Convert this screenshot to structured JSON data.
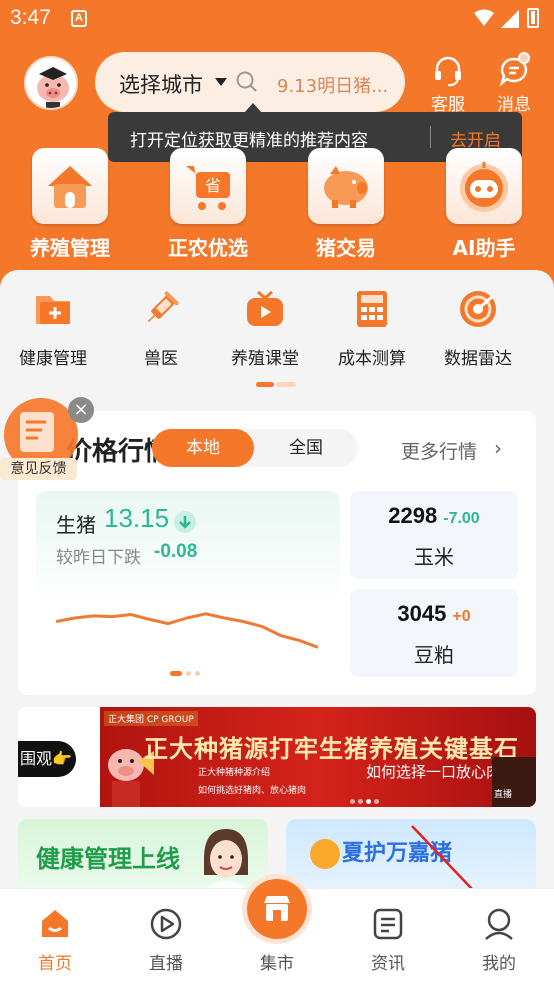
{
  "status_bar": {
    "time": "3:47",
    "app_icon_letter": "A"
  },
  "header": {
    "city_label": "选择城市",
    "search_placeholder": "9.13明日猪...",
    "actions": {
      "service": "客服",
      "messages": "消息"
    },
    "colors": {
      "brand": "#f5772a",
      "tooltip_bg": "#3a3a3a"
    }
  },
  "tooltip": {
    "text": "打开定位获取更精准的推荐内容",
    "action": "去开启"
  },
  "main_tiles": [
    {
      "label": "养殖管理",
      "icon": "house-icon"
    },
    {
      "label": "正农优选",
      "icon": "shopping-cart-icon"
    },
    {
      "label": "猪交易",
      "icon": "piggy-icon"
    },
    {
      "label": "AI助手",
      "icon": "robot-icon"
    }
  ],
  "grid_items": [
    {
      "label": "健康管理",
      "icon": "health-folder-icon"
    },
    {
      "label": "兽医",
      "icon": "syringe-icon"
    },
    {
      "label": "养殖课堂",
      "icon": "tv-play-icon"
    },
    {
      "label": "成本测算",
      "icon": "calculator-icon"
    },
    {
      "label": "数据雷达",
      "icon": "radar-icon"
    }
  ],
  "feedback": {
    "label": "意见反馈"
  },
  "price_market": {
    "title": "价格行情",
    "tabs": [
      "本地",
      "全国"
    ],
    "active_tab": "本地",
    "more": "更多行情",
    "hog": {
      "name": "生猪",
      "price": "13.15",
      "change_label": "较昨日下跌",
      "change": "-0.08",
      "trend": [
        0.55,
        0.5,
        0.47,
        0.48,
        0.45,
        0.52,
        0.58,
        0.5,
        0.44,
        0.5,
        0.55,
        0.62,
        0.75,
        0.82,
        0.92
      ]
    },
    "corn": {
      "name": "玉米",
      "price": "2298",
      "change": "-7.00",
      "change_color": "#2bb894"
    },
    "meal": {
      "name": "豆粕",
      "price": "3045",
      "change": "+0",
      "change_color": "#f5772a"
    }
  },
  "banner": {
    "left_text": "围观👉",
    "logo": "正大集团 CP GROUP",
    "title": "正大种猪源打牢生猪养殖关键基石",
    "subtitle": "如何选择一口放心肉",
    "line1": "正大种猪种源介绍",
    "line2": "如何挑选好猪肉、放心猪肉",
    "live_label": "直播"
  },
  "promos": {
    "health": "健康管理上线",
    "summer": "夏护万嘉猪"
  },
  "bottom_nav": [
    {
      "label": "首页",
      "icon": "home-icon",
      "active": true
    },
    {
      "label": "直播",
      "icon": "play-circle-icon",
      "active": false
    },
    {
      "label": "集市",
      "icon": "store-icon",
      "active": false
    },
    {
      "label": "资讯",
      "icon": "news-icon",
      "active": false
    },
    {
      "label": "我的",
      "icon": "user-icon",
      "active": false
    }
  ]
}
